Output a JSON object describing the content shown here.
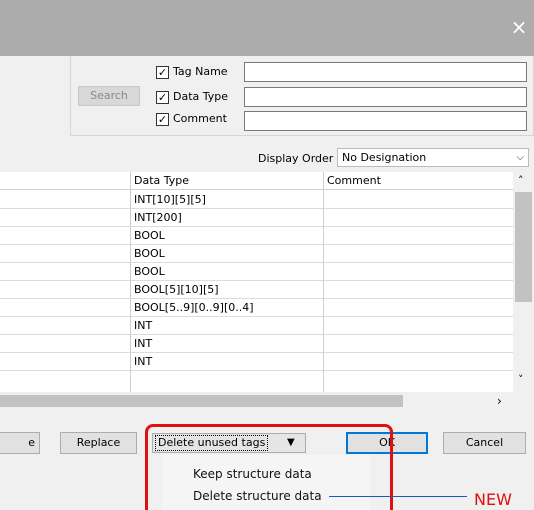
{
  "window": {
    "close_icon": "×"
  },
  "search": {
    "button_label": "Search",
    "tag_name_label": "Tag Name",
    "data_type_label": "Data Type",
    "comment_label": "Comment",
    "tag_name_checked": true,
    "data_type_checked": true,
    "comment_checked": true,
    "tag_name_value": "",
    "data_type_value": "",
    "comment_value": ""
  },
  "display_order": {
    "label": "Display Order",
    "value": "No Designation"
  },
  "table": {
    "columns": [
      "Data Type",
      "Comment"
    ],
    "rows": [
      {
        "data_type": "INT[10][5][5]",
        "comment": ""
      },
      {
        "data_type": "INT[200]",
        "comment": ""
      },
      {
        "data_type": "BOOL",
        "comment": ""
      },
      {
        "data_type": "BOOL",
        "comment": ""
      },
      {
        "data_type": "BOOL",
        "comment": ""
      },
      {
        "data_type": "BOOL[5][10][5]",
        "comment": ""
      },
      {
        "data_type": "BOOL[5..9][0..9][0..4]",
        "comment": ""
      },
      {
        "data_type": "INT",
        "comment": ""
      },
      {
        "data_type": "INT",
        "comment": ""
      },
      {
        "data_type": "INT",
        "comment": ""
      }
    ]
  },
  "bottom_bar": {
    "left_partial_label": "e",
    "replace_label": "Replace",
    "delete_unused_label": "Delete unused tags",
    "ok_label": "OK",
    "cancel_label": "Cancel"
  },
  "dropdown_menu": {
    "items": [
      "Keep structure data",
      "Delete structure data"
    ]
  },
  "callout": {
    "text": "NEW"
  },
  "colors": {
    "highlight": "#e01010",
    "title_bar": "#acacac",
    "ok_border": "#0078d7"
  }
}
